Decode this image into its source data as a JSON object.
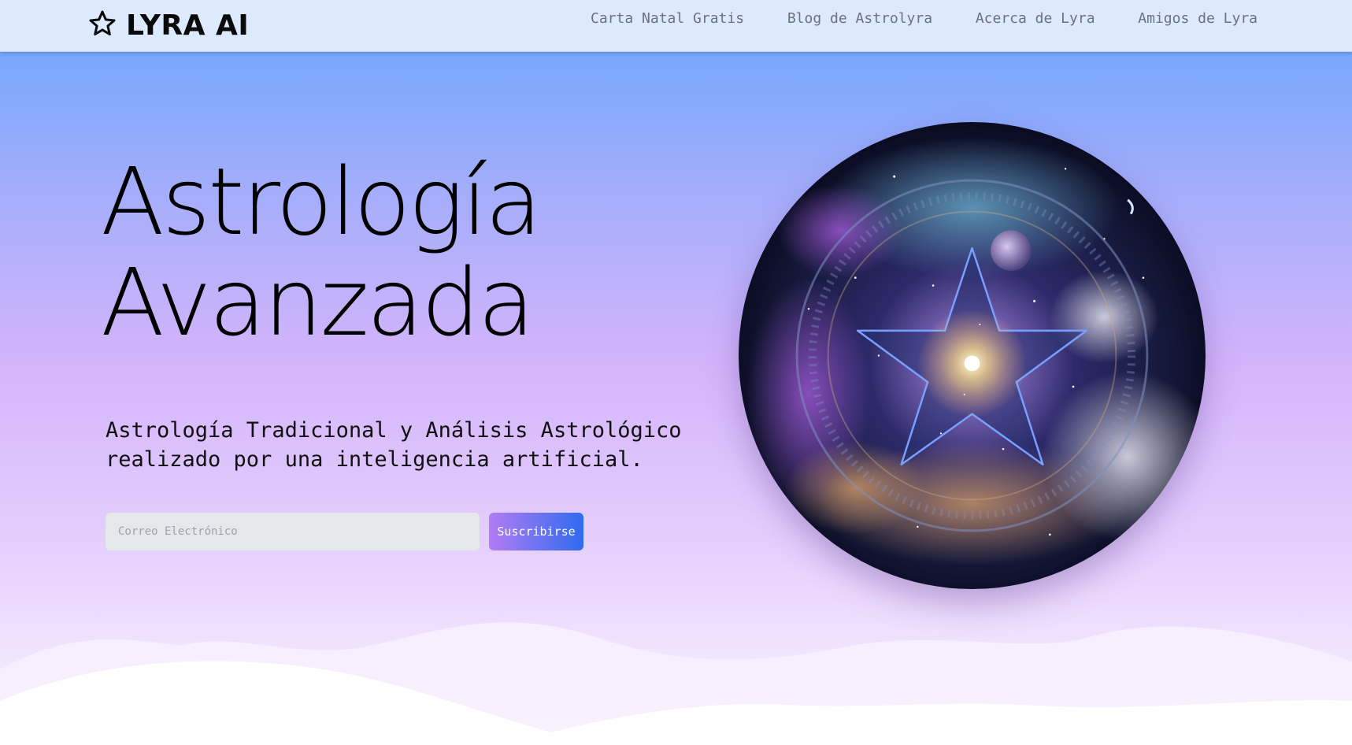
{
  "brand": {
    "name": "LYRA AI",
    "icon": "star-outline-icon"
  },
  "nav": {
    "links": [
      {
        "label": "Carta Natal Gratis"
      },
      {
        "label": "Blog de Astrolyra"
      },
      {
        "label": "Acerca de Lyra"
      },
      {
        "label": "Amigos de Lyra"
      }
    ]
  },
  "hero": {
    "title_line1": "Astrología",
    "title_line2": "Avanzada",
    "subtitle_line1": "Astrología Tradicional y Análisis Astrológico",
    "subtitle_line2": "realizado por una inteligencia artificial.",
    "email_placeholder": "Correo Electrónico",
    "email_value": "",
    "subscribe_label": "Suscribirse",
    "image_subject": "cosmic-pentagram-orb"
  },
  "colors": {
    "nav_background": "#dde9fd",
    "gradient_top": "#76a7fb",
    "gradient_mid": "#d3b4fb",
    "button_start": "#b27cf4",
    "button_end": "#2f6bef",
    "nav_link": "#6b7280"
  }
}
